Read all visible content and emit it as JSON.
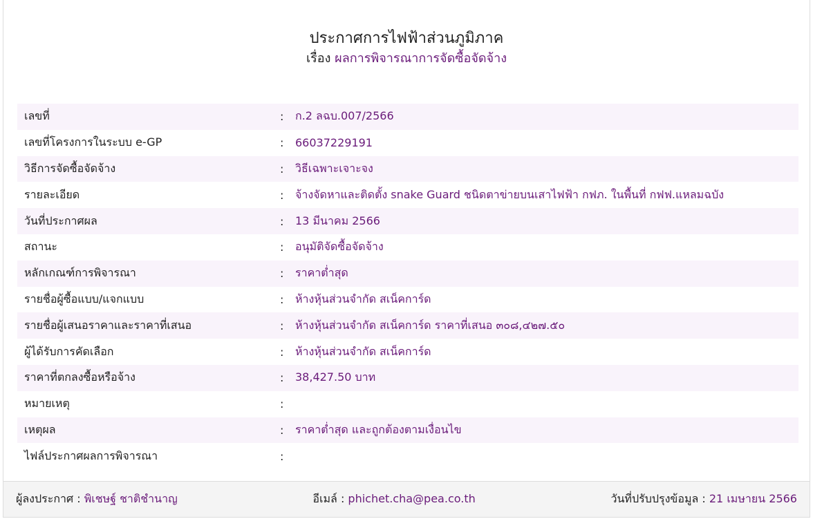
{
  "header": {
    "title": "ประกาศการไฟฟ้าส่วนภูมิภาค",
    "subtitle_prefix": "เรื่อง",
    "subtitle_value": "ผลการพิจารณาการจัดซื้อจัดจ้าง"
  },
  "separator": ":",
  "details": [
    {
      "label": "เลขที่",
      "value": "ก.2 ลฉบ.007/2566"
    },
    {
      "label": "เลขที่โครงการในระบบ e-GP",
      "value": "66037229191"
    },
    {
      "label": "วิธีการจัดซื้อจัดจ้าง",
      "value": "วิธีเฉพาะเจาะจง"
    },
    {
      "label": "รายละเอียด",
      "value": "จ้างจัดหาและติดตั้ง snake Guard ชนิดตาข่ายบนเสาไฟฟ้า กฟภ. ในพื้นที่ กฟฟ.แหลมฉบัง"
    },
    {
      "label": "วันที่ประกาศผล",
      "value": "13 มีนาคม 2566"
    },
    {
      "label": "สถานะ",
      "value": "อนุมัติจัดซื้อจัดจ้าง"
    },
    {
      "label": "หลักเกณฑ์การพิจารณา",
      "value": "ราคาต่ำสุด"
    },
    {
      "label": "รายชื่อผู้ซื้อแบบ/แจกแบบ",
      "value": "ห้างหุ้นส่วนจำกัด สเน็คการ์ด"
    },
    {
      "label": "รายชื่อผู้เสนอราคาและราคาที่เสนอ",
      "value": "ห้างหุ้นส่วนจำกัด สเน็คการ์ด ราคาที่เสนอ ๓๐๘,๔๒๗.๕๐"
    },
    {
      "label": "ผู้ได้รับการคัดเลือก",
      "value": "ห้างหุ้นส่วนจำกัด สเน็คการ์ด"
    },
    {
      "label": "ราคาที่ตกลงซื้อหรือจ้าง",
      "value": "38,427.50 บาท"
    },
    {
      "label": "หมายเหตุ",
      "value": ""
    },
    {
      "label": "เหตุผล",
      "value": "ราคาต่ำสุด และถูกต้องตามเงื่อนไข"
    },
    {
      "label": "ไฟล์ประกาศผลการพิจารณา",
      "value": ""
    }
  ],
  "footer": {
    "announcer_label": "ผู้ลงประกาศ :",
    "announcer_value": "พิเชษฐ์ ชาติชำนาญ",
    "email_label": "อีเมล์ :",
    "email_value": "phichet.cha@pea.co.th",
    "updated_label": "วันที่ปรับปรุงข้อมูล :",
    "updated_value": "21 เมษายน 2566"
  }
}
